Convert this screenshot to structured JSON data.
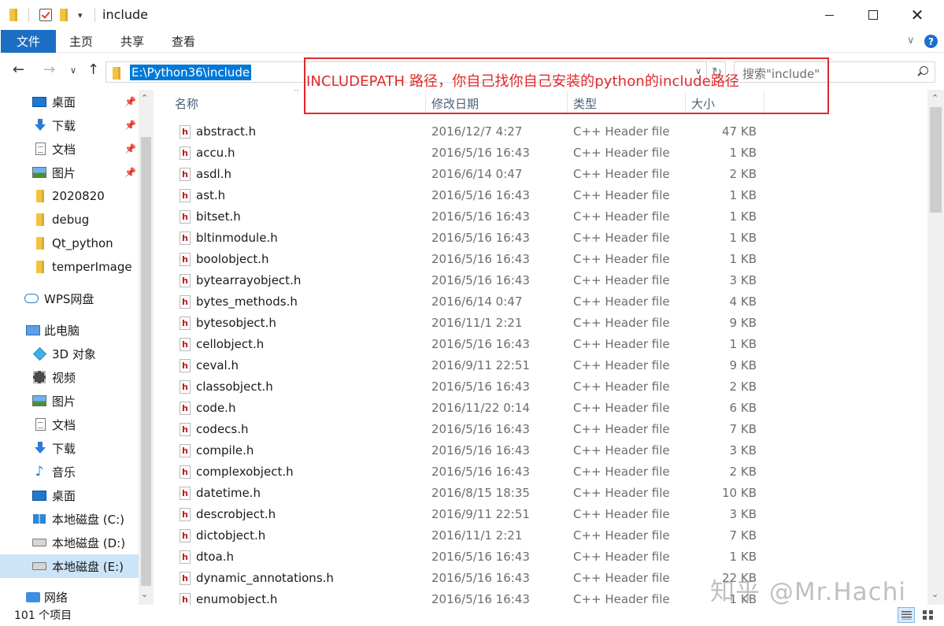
{
  "window": {
    "title": "include",
    "quick_access_dropdown": "▾",
    "minimize": "—",
    "maximize": "☐",
    "close": "✕"
  },
  "ribbon": {
    "tabs": [
      "文件",
      "主页",
      "共享",
      "查看"
    ],
    "expand": "∨",
    "help": "?"
  },
  "nav": {
    "back": "←",
    "forward": "→",
    "recent": "∨",
    "up": "↑",
    "address": "E:\\Python36\\include",
    "address_dropdown": "∨",
    "refresh": "↻",
    "search_placeholder": "搜索\"include\""
  },
  "annotation": {
    "text": "INCLUDEPATH 路径，你自己找你自己安装的python的include路径",
    "color": "#e0292b"
  },
  "sidebar": {
    "items": [
      {
        "label": "桌面",
        "icon": "desktop-icon",
        "pinned": true
      },
      {
        "label": "下载",
        "icon": "download-icon",
        "pinned": true
      },
      {
        "label": "文档",
        "icon": "document-icon",
        "pinned": true
      },
      {
        "label": "图片",
        "icon": "pictures-icon",
        "pinned": true
      },
      {
        "label": "2020820",
        "icon": "folder-icon",
        "pinned": false
      },
      {
        "label": "debug",
        "icon": "folder-icon",
        "pinned": false
      },
      {
        "label": "Qt_python",
        "icon": "folder-icon",
        "pinned": false
      },
      {
        "label": "temperImage",
        "icon": "folder-icon",
        "pinned": false
      },
      {
        "label": "WPS网盘",
        "icon": "cloud-icon",
        "pinned": false
      },
      {
        "label": "此电脑",
        "icon": "computer-icon",
        "pinned": false
      },
      {
        "label": "3D 对象",
        "icon": "3d-objects-icon",
        "pinned": false
      },
      {
        "label": "视频",
        "icon": "video-icon",
        "pinned": false
      },
      {
        "label": "图片",
        "icon": "pictures-icon",
        "pinned": false
      },
      {
        "label": "文档",
        "icon": "document-icon",
        "pinned": false
      },
      {
        "label": "下载",
        "icon": "download-icon",
        "pinned": false
      },
      {
        "label": "音乐",
        "icon": "music-icon",
        "pinned": false
      },
      {
        "label": "桌面",
        "icon": "desktop-icon",
        "pinned": false
      },
      {
        "label": "本地磁盘 (C:)",
        "icon": "system-drive-icon",
        "pinned": false
      },
      {
        "label": "本地磁盘 (D:)",
        "icon": "drive-icon",
        "pinned": false
      },
      {
        "label": "本地磁盘 (E:)",
        "icon": "drive-icon",
        "pinned": false,
        "selected": true
      },
      {
        "label": "网络",
        "icon": "network-icon",
        "pinned": false
      }
    ],
    "pin_glyph": "📌"
  },
  "filelist": {
    "columns": [
      "名称",
      "修改日期",
      "类型",
      "大小"
    ],
    "sort_indicator": "^",
    "rows": [
      {
        "name": "abstract.h",
        "date": "2016/12/7 4:27",
        "type": "C++ Header file",
        "size": "47 KB"
      },
      {
        "name": "accu.h",
        "date": "2016/5/16 16:43",
        "type": "C++ Header file",
        "size": "1 KB"
      },
      {
        "name": "asdl.h",
        "date": "2016/6/14 0:47",
        "type": "C++ Header file",
        "size": "2 KB"
      },
      {
        "name": "ast.h",
        "date": "2016/5/16 16:43",
        "type": "C++ Header file",
        "size": "1 KB"
      },
      {
        "name": "bitset.h",
        "date": "2016/5/16 16:43",
        "type": "C++ Header file",
        "size": "1 KB"
      },
      {
        "name": "bltinmodule.h",
        "date": "2016/5/16 16:43",
        "type": "C++ Header file",
        "size": "1 KB"
      },
      {
        "name": "boolobject.h",
        "date": "2016/5/16 16:43",
        "type": "C++ Header file",
        "size": "1 KB"
      },
      {
        "name": "bytearrayobject.h",
        "date": "2016/5/16 16:43",
        "type": "C++ Header file",
        "size": "3 KB"
      },
      {
        "name": "bytes_methods.h",
        "date": "2016/6/14 0:47",
        "type": "C++ Header file",
        "size": "4 KB"
      },
      {
        "name": "bytesobject.h",
        "date": "2016/11/1 2:21",
        "type": "C++ Header file",
        "size": "9 KB"
      },
      {
        "name": "cellobject.h",
        "date": "2016/5/16 16:43",
        "type": "C++ Header file",
        "size": "1 KB"
      },
      {
        "name": "ceval.h",
        "date": "2016/9/11 22:51",
        "type": "C++ Header file",
        "size": "9 KB"
      },
      {
        "name": "classobject.h",
        "date": "2016/5/16 16:43",
        "type": "C++ Header file",
        "size": "2 KB"
      },
      {
        "name": "code.h",
        "date": "2016/11/22 0:14",
        "type": "C++ Header file",
        "size": "6 KB"
      },
      {
        "name": "codecs.h",
        "date": "2016/5/16 16:43",
        "type": "C++ Header file",
        "size": "7 KB"
      },
      {
        "name": "compile.h",
        "date": "2016/5/16 16:43",
        "type": "C++ Header file",
        "size": "3 KB"
      },
      {
        "name": "complexobject.h",
        "date": "2016/5/16 16:43",
        "type": "C++ Header file",
        "size": "2 KB"
      },
      {
        "name": "datetime.h",
        "date": "2016/8/15 18:35",
        "type": "C++ Header file",
        "size": "10 KB"
      },
      {
        "name": "descrobject.h",
        "date": "2016/9/11 22:51",
        "type": "C++ Header file",
        "size": "3 KB"
      },
      {
        "name": "dictobject.h",
        "date": "2016/11/1 2:21",
        "type": "C++ Header file",
        "size": "7 KB"
      },
      {
        "name": "dtoa.h",
        "date": "2016/5/16 16:43",
        "type": "C++ Header file",
        "size": "1 KB"
      },
      {
        "name": "dynamic_annotations.h",
        "date": "2016/5/16 16:43",
        "type": "C++ Header file",
        "size": "22 KB"
      },
      {
        "name": "enumobject.h",
        "date": "2016/5/16 16:43",
        "type": "C++ Header file",
        "size": "1 KB"
      }
    ],
    "file_icon_glyph": "h"
  },
  "watermark": "知乎 @Mr.Hachi",
  "status": {
    "item_count": "101 个项目"
  }
}
